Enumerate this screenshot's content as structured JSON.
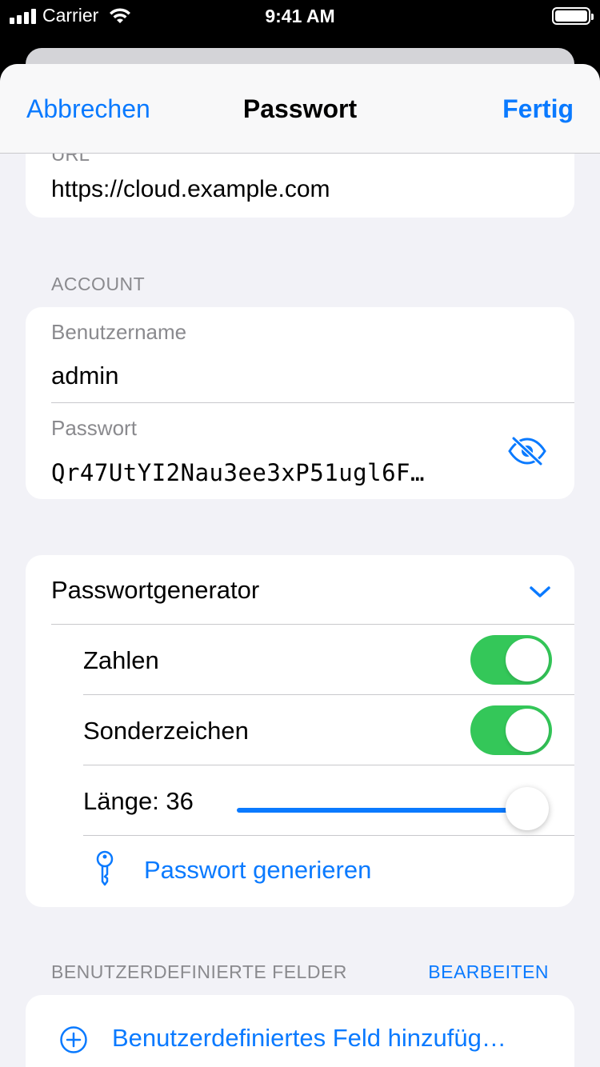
{
  "status_bar": {
    "carrier": "Carrier",
    "time": "9:41 AM"
  },
  "nav": {
    "cancel_label": "Abbrechen",
    "title": "Passwort",
    "done_label": "Fertig"
  },
  "url_section": {
    "label": "URL",
    "value": "https://cloud.example.com"
  },
  "account_section": {
    "header": "ACCOUNT",
    "username_label": "Benutzername",
    "username_value": "admin",
    "password_label": "Passwort",
    "password_value": "Qr47UtYI2Nau3ee3xP51ugl6F…",
    "reveal_icon": "eye-slash-icon"
  },
  "generator": {
    "title": "Passwortgenerator",
    "numbers_label": "Zahlen",
    "numbers_on": true,
    "special_label": "Sonderzeichen",
    "special_on": true,
    "length_label": "Länge: 36",
    "length_value": 36,
    "generate_label": "Passwort generieren"
  },
  "custom_fields": {
    "header": "BENUTZERDEFINIERTE FELDER",
    "edit_label": "BEARBEITEN",
    "add_label": "Benutzerdefiniertes Feld hinzufüg…"
  },
  "colors": {
    "accent": "#0a7aff",
    "toggle_on": "#34c759",
    "background": "#f2f2f7"
  }
}
